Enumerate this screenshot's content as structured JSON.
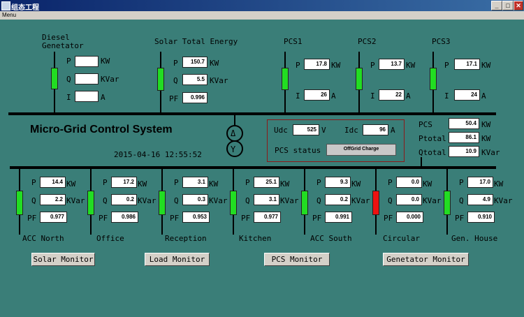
{
  "window": {
    "title": "组态工程",
    "menu": "Menu"
  },
  "title": "Micro-Grid Control System",
  "datetime": "2015-04-16  12:55:52",
  "units": {
    "kw": "KW",
    "kvar": "KVar",
    "a": "A",
    "v": "V"
  },
  "labels": {
    "p": "P",
    "q": "Q",
    "i": "I",
    "pf": "PF",
    "udc": "Udc",
    "idc": "Idc",
    "pcs_status": "PCS status",
    "pcs": "PCS",
    "ptotal": "Ptotal",
    "qtotal": "Qtotal"
  },
  "diesel": {
    "name": "Diesel\nGenetator",
    "p": "",
    "q": "",
    "i": ""
  },
  "solar": {
    "name": "Solar Total Energy",
    "p": "150.7",
    "q": "5.5",
    "pf": "0.996"
  },
  "pcs1": {
    "name": "PCS1",
    "p": "17.8",
    "i": "26"
  },
  "pcs2": {
    "name": "PCS2",
    "p": "13.7",
    "i": "22"
  },
  "pcs3": {
    "name": "PCS3",
    "p": "17.1",
    "i": "24"
  },
  "dc": {
    "udc": "525",
    "idc": "96",
    "status": "OffGrid Charge"
  },
  "totals": {
    "pcs": "50.4",
    "ptotal": "86.1",
    "qtotal": "10.9"
  },
  "loads": [
    {
      "name": "ACC North",
      "p": "14.4",
      "q": "2.2",
      "pf": "0.977",
      "state": "on",
      "color": "#22dd22"
    },
    {
      "name": "Office",
      "p": "17.2",
      "q": "0.2",
      "pf": "0.986",
      "state": "on",
      "color": "#22dd22"
    },
    {
      "name": "Reception",
      "p": "3.1",
      "q": "0.3",
      "pf": "0.953",
      "state": "on",
      "color": "#22dd22"
    },
    {
      "name": "Kitchen",
      "p": "25.1",
      "q": "3.1",
      "pf": "0.977",
      "state": "on",
      "color": "#22dd22"
    },
    {
      "name": "ACC South",
      "p": "9.3",
      "q": "0.2",
      "pf": "0.991",
      "state": "on",
      "color": "#22dd22"
    },
    {
      "name": "Circular",
      "p": "0.0",
      "q": "0.0",
      "pf": "0.000",
      "state": "off",
      "color": "#ee1111"
    },
    {
      "name": "Gen. House",
      "p": "17.0",
      "q": "4.9",
      "pf": "0.910",
      "state": "on",
      "color": "#22dd22"
    }
  ],
  "buttons": {
    "solar": "Solar Monitor",
    "load": "Load Monitor",
    "pcs": "PCS Monitor",
    "generator": "Genetator Monitor"
  }
}
